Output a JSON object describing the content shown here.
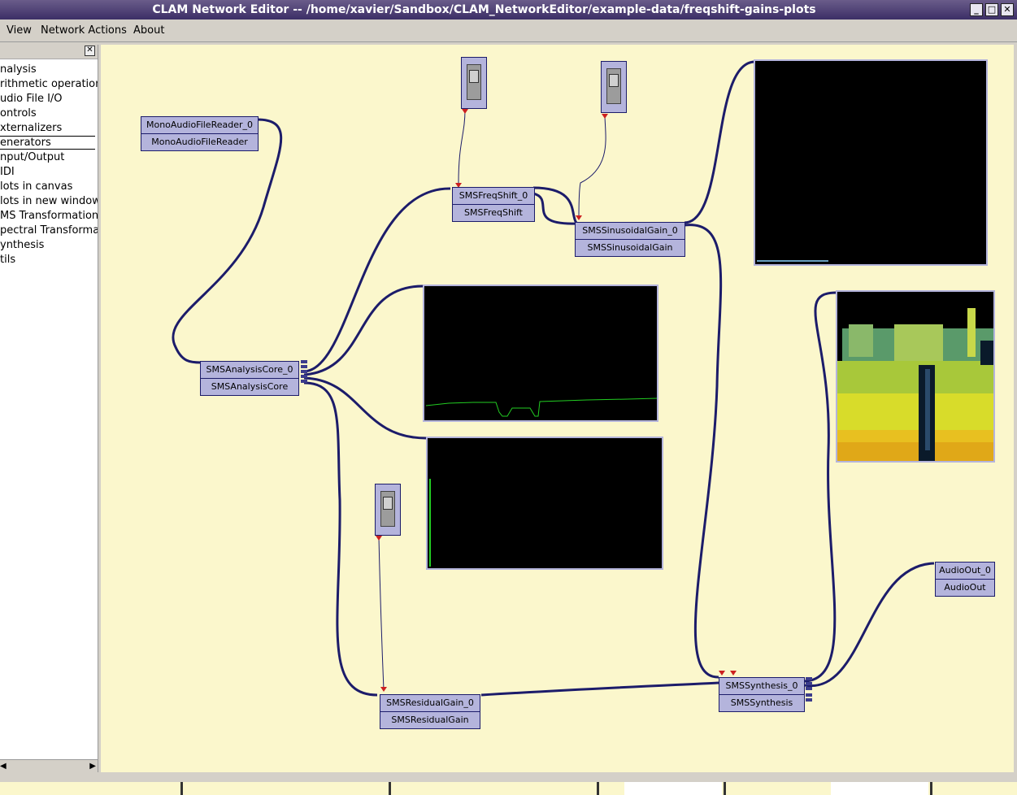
{
  "window": {
    "title": "CLAM Network Editor -- /home/xavier/Sandbox/CLAM_NetworkEditor/example-data/freqshift-gains-plots",
    "buttons": [
      "_",
      "□",
      "✕"
    ]
  },
  "menu": [
    "View",
    "Network Actions",
    "About"
  ],
  "sidebar": {
    "items": [
      {
        "label": "nalysis"
      },
      {
        "label": "rithmetic operation"
      },
      {
        "label": "udio File I/O"
      },
      {
        "label": "ontrols"
      },
      {
        "label": "xternalizers"
      },
      {
        "label": "enerators"
      },
      {
        "label": "nput/Output"
      },
      {
        "label": "IDI"
      },
      {
        "label": "lots in canvas"
      },
      {
        "label": "lots in new window"
      },
      {
        "label": "MS Transformation"
      },
      {
        "label": "pectral Transforma"
      },
      {
        "label": "ynthesis"
      },
      {
        "label": "tils"
      }
    ],
    "selected_index": 5
  },
  "nodes": [
    {
      "name": "MonoAudioFileReader_0",
      "type": "MonoAudioFileReader"
    },
    {
      "name": "SMSFreqShift_0",
      "type": "SMSFreqShift"
    },
    {
      "name": "SMSSinusoidalGain_0",
      "type": "SMSSinusoidalGain"
    },
    {
      "name": "SMSAnalysisCore_0",
      "type": "SMSAnalysisCore"
    },
    {
      "name": "SMSResidualGain_0",
      "type": "SMSResidualGain"
    },
    {
      "name": "SMSSynthesis_0",
      "type": "SMSSynthesis"
    },
    {
      "name": "AudioOut_0",
      "type": "AudioOut"
    }
  ],
  "colors": {
    "canvas": "#fbf7cc",
    "node": "#b4b4dc",
    "wire": "#1c1c6a",
    "plot_line": "#22cc22"
  }
}
